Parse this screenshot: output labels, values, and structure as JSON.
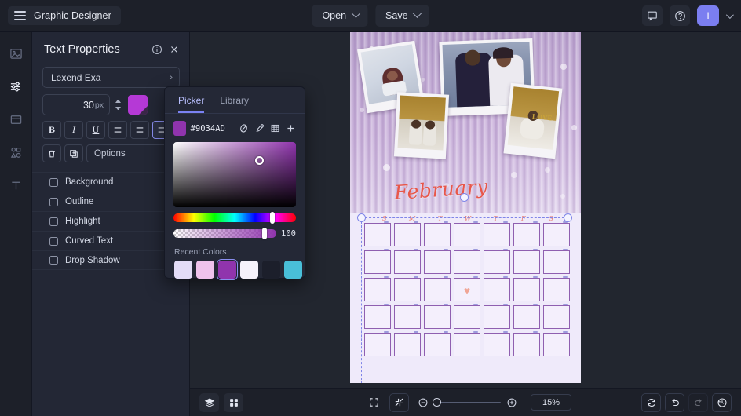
{
  "topbar": {
    "brand": "Graphic Designer",
    "menu_icon": "hamburger-icon",
    "open_label": "Open",
    "save_label": "Save",
    "comment_icon": "comment-icon",
    "help_icon": "help-circle-icon",
    "avatar_initial": "I"
  },
  "rail": {
    "items": [
      {
        "name": "image-icon"
      },
      {
        "name": "adjustments-icon"
      },
      {
        "name": "layout-icon"
      },
      {
        "name": "shapes-icon"
      },
      {
        "name": "text-icon"
      }
    ]
  },
  "panel": {
    "title": "Text Properties",
    "info_icon": "info-circle-icon",
    "close_icon": "close-icon",
    "font_family": "Lexend Exa",
    "font_size": "30",
    "font_size_unit": "px",
    "text_color": "#B539D6",
    "bold_label": "B",
    "italic_label": "I",
    "underline_label": "U",
    "align_left_icon": "align-left-icon",
    "align_center_icon": "align-center-icon",
    "align_right_icon": "align-right-icon",
    "delete_icon": "trash-icon",
    "duplicate_icon": "duplicate-icon",
    "options_label": "Options",
    "checkboxes": [
      {
        "label": "Background",
        "checked": false
      },
      {
        "label": "Outline",
        "checked": false
      },
      {
        "label": "Highlight",
        "checked": false
      },
      {
        "label": "Curved Text",
        "checked": false
      },
      {
        "label": "Drop Shadow",
        "checked": false
      }
    ]
  },
  "picker": {
    "tabs": [
      {
        "label": "Picker",
        "active": true
      },
      {
        "label": "Library",
        "active": false
      }
    ],
    "hex": "#9034AD",
    "tools": [
      {
        "name": "no-color-icon"
      },
      {
        "name": "eyedropper-icon"
      },
      {
        "name": "palette-grid-icon"
      },
      {
        "name": "add-color-icon"
      }
    ],
    "alpha_value": "100",
    "recent_title": "Recent Colors",
    "recent_colors": [
      {
        "hex": "#E3DCF7",
        "selected": false
      },
      {
        "hex": "#EFC2EC",
        "selected": false
      },
      {
        "hex": "#9034AD",
        "selected": true
      },
      {
        "hex": "#F5F2FB",
        "selected": false
      },
      {
        "hex": "#1C1F2B",
        "selected": false
      },
      {
        "hex": "#49BFD8",
        "selected": false
      }
    ]
  },
  "canvas": {
    "month_title": "February",
    "day_headers": [
      "S",
      "M",
      "T",
      "W",
      "T",
      "F",
      "S"
    ],
    "cell_tag_count": 35,
    "heart_cell_index": 17,
    "heart_glyph": "♥"
  },
  "bottombar": {
    "layers_icon": "layers-icon",
    "grid_icon": "grid-icon",
    "fit_icon": "fit-screen-icon",
    "shrink_icon": "shrink-icon",
    "zoom_out_icon": "zoom-out-icon",
    "zoom_in_icon": "zoom-in-icon",
    "zoom_level": "15%",
    "reset_icon": "reset-icon",
    "undo_icon": "undo-icon",
    "redo_icon": "redo-icon",
    "history_icon": "history-icon"
  }
}
